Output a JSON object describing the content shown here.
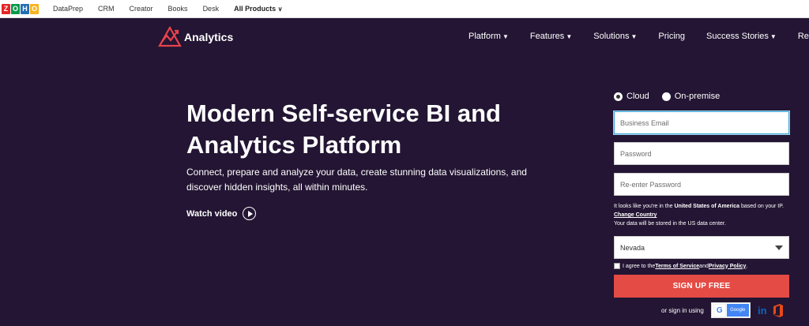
{
  "topbar": {
    "logo_letters": [
      "Z",
      "O",
      "H",
      "O"
    ],
    "logo_colors": [
      "#e42527",
      "#089949",
      "#226db4",
      "#f9b21d"
    ],
    "links": [
      "DataPrep",
      "CRM",
      "Creator",
      "Books",
      "Desk"
    ],
    "all_products": "All Products"
  },
  "nav": {
    "brand": "Analytics",
    "items": [
      "Platform",
      "Features",
      "Solutions",
      "Pricing",
      "Success Stories",
      "Resourc"
    ]
  },
  "hero": {
    "title": "Modern Self-service BI and Analytics Platform",
    "subtitle": "Connect, prepare and analyze your data, create stunning data visualizations, and discover hidden insights, all within minutes.",
    "watch_video": "Watch video"
  },
  "signup": {
    "radio_cloud": "Cloud",
    "radio_onpremise": "On-premise",
    "email_placeholder": "Business Email",
    "password_placeholder": "Password",
    "reenter_placeholder": "Re-enter Password",
    "ip_note_pre": "It looks like you're in the ",
    "ip_note_country": "United States of America",
    "ip_note_post": " based on your IP. ",
    "change_country": "Change Country",
    "data_center_note": "Your data will be stored in the US data center.",
    "state_selected": "Nevada",
    "agree_pre": "I agree to the ",
    "terms": "Terms of Service",
    "agree_and": " and ",
    "privacy": "Privacy Policy",
    "agree_end": ".",
    "button": "SIGN UP FREE",
    "or_sign_in": "or sign in using",
    "google_label": "Google",
    "linkedin_label": "in"
  },
  "colors": {
    "background": "#231533",
    "signup_button": "#e44b45",
    "brand_icon": "#e8424b"
  },
  "icons": [
    "analytics-logo-icon",
    "chevron-down-icon",
    "play-icon",
    "google-icon",
    "linkedin-icon",
    "office-icon"
  ]
}
